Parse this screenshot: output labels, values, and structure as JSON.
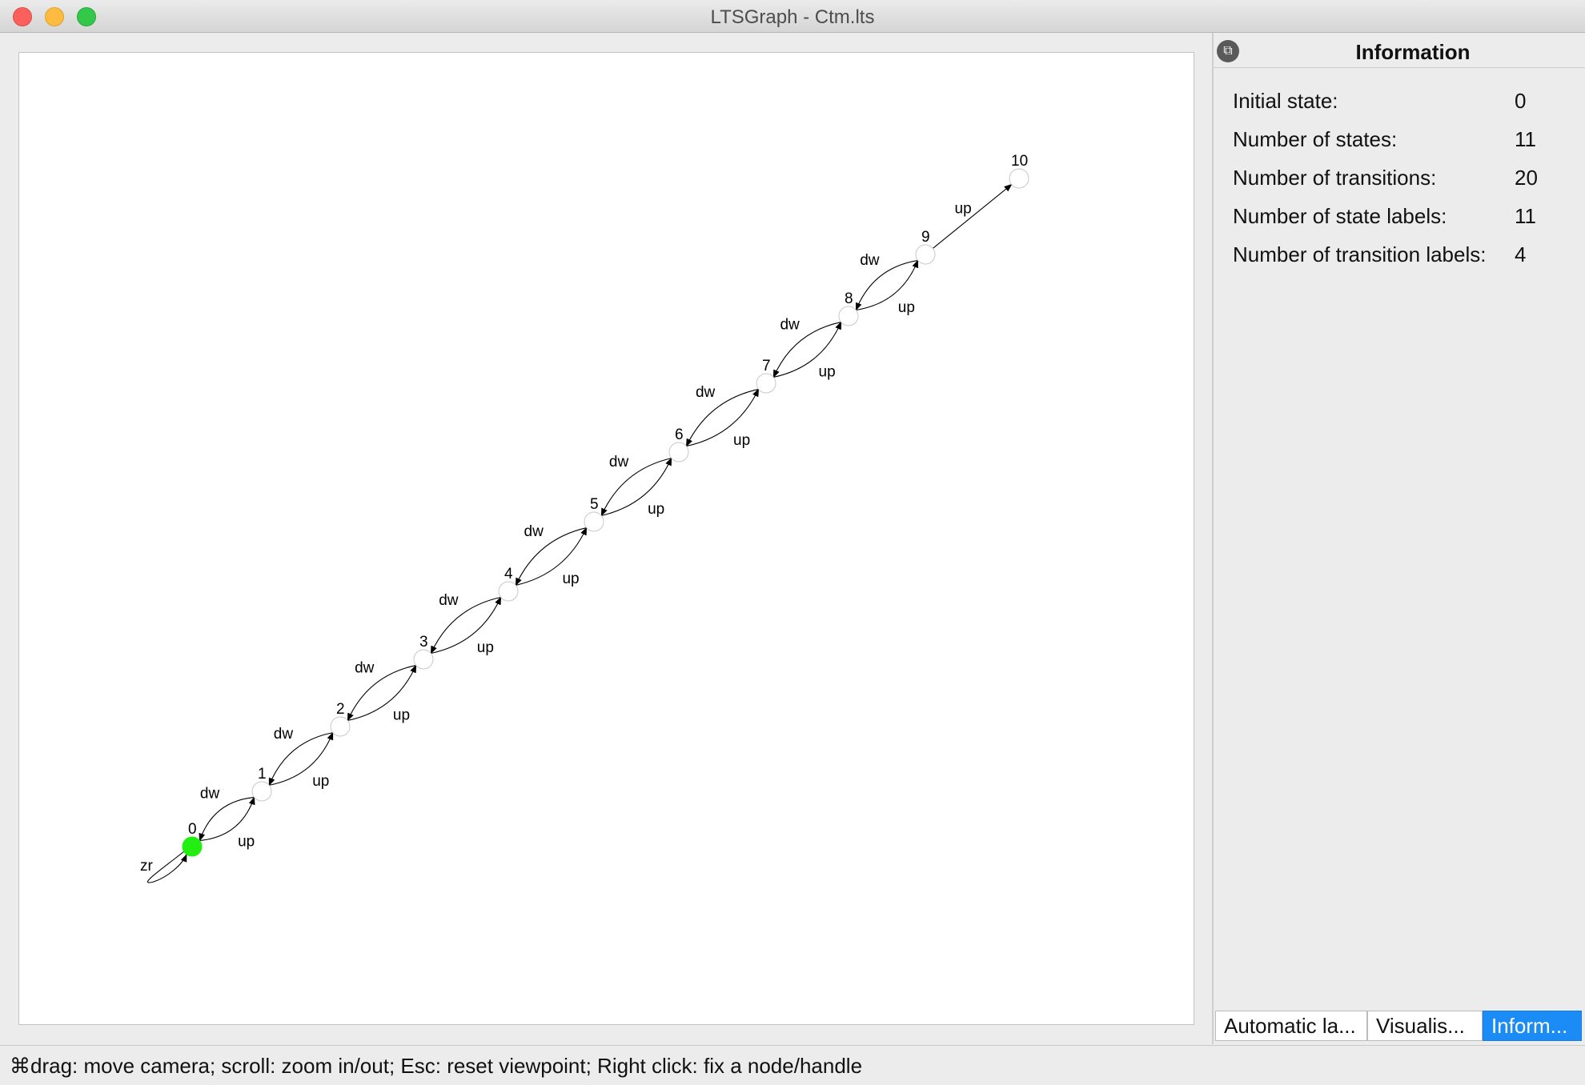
{
  "window": {
    "title": "LTSGraph - Ctm.lts"
  },
  "graph": {
    "initial_state_color": "#22ee11",
    "states": [
      {
        "id": "0",
        "initial": true
      },
      {
        "id": "1"
      },
      {
        "id": "2"
      },
      {
        "id": "3"
      },
      {
        "id": "4"
      },
      {
        "id": "5"
      },
      {
        "id": "6"
      },
      {
        "id": "7"
      },
      {
        "id": "8"
      },
      {
        "id": "9"
      },
      {
        "id": "10"
      }
    ],
    "transitions": [
      {
        "from": "0",
        "to": "0",
        "label": "zr"
      },
      {
        "from": "0",
        "to": "1",
        "label": "up"
      },
      {
        "from": "1",
        "to": "0",
        "label": "dw"
      },
      {
        "from": "1",
        "to": "2",
        "label": "up"
      },
      {
        "from": "2",
        "to": "1",
        "label": "dw"
      },
      {
        "from": "2",
        "to": "3",
        "label": "up"
      },
      {
        "from": "3",
        "to": "2",
        "label": "dw"
      },
      {
        "from": "3",
        "to": "4",
        "label": "up"
      },
      {
        "from": "4",
        "to": "3",
        "label": "dw"
      },
      {
        "from": "4",
        "to": "5",
        "label": "up"
      },
      {
        "from": "5",
        "to": "4",
        "label": "dw"
      },
      {
        "from": "5",
        "to": "6",
        "label": "up"
      },
      {
        "from": "6",
        "to": "5",
        "label": "dw"
      },
      {
        "from": "6",
        "to": "7",
        "label": "up"
      },
      {
        "from": "7",
        "to": "6",
        "label": "dw"
      },
      {
        "from": "7",
        "to": "8",
        "label": "up"
      },
      {
        "from": "8",
        "to": "7",
        "label": "dw"
      },
      {
        "from": "8",
        "to": "9",
        "label": "up"
      },
      {
        "from": "9",
        "to": "8",
        "label": "dw"
      },
      {
        "from": "9",
        "to": "10",
        "label": "up"
      }
    ]
  },
  "info": {
    "title": "Information",
    "rows": [
      {
        "label": "Initial state:",
        "value": "0"
      },
      {
        "label": "Number of states:",
        "value": "11"
      },
      {
        "label": "Number of transitions:",
        "value": "20"
      },
      {
        "label": "Number of state labels:",
        "value": "11"
      },
      {
        "label": "Number of transition labels:",
        "value": "4"
      }
    ]
  },
  "tabs": [
    {
      "label": "Automatic la...",
      "active": false
    },
    {
      "label": "Visualis...",
      "active": false
    },
    {
      "label": "Inform...",
      "active": true
    }
  ],
  "status": {
    "text": "⌘drag: move camera; scroll: zoom in/out; Esc: reset viewpoint; Right click: fix a node/handle"
  }
}
